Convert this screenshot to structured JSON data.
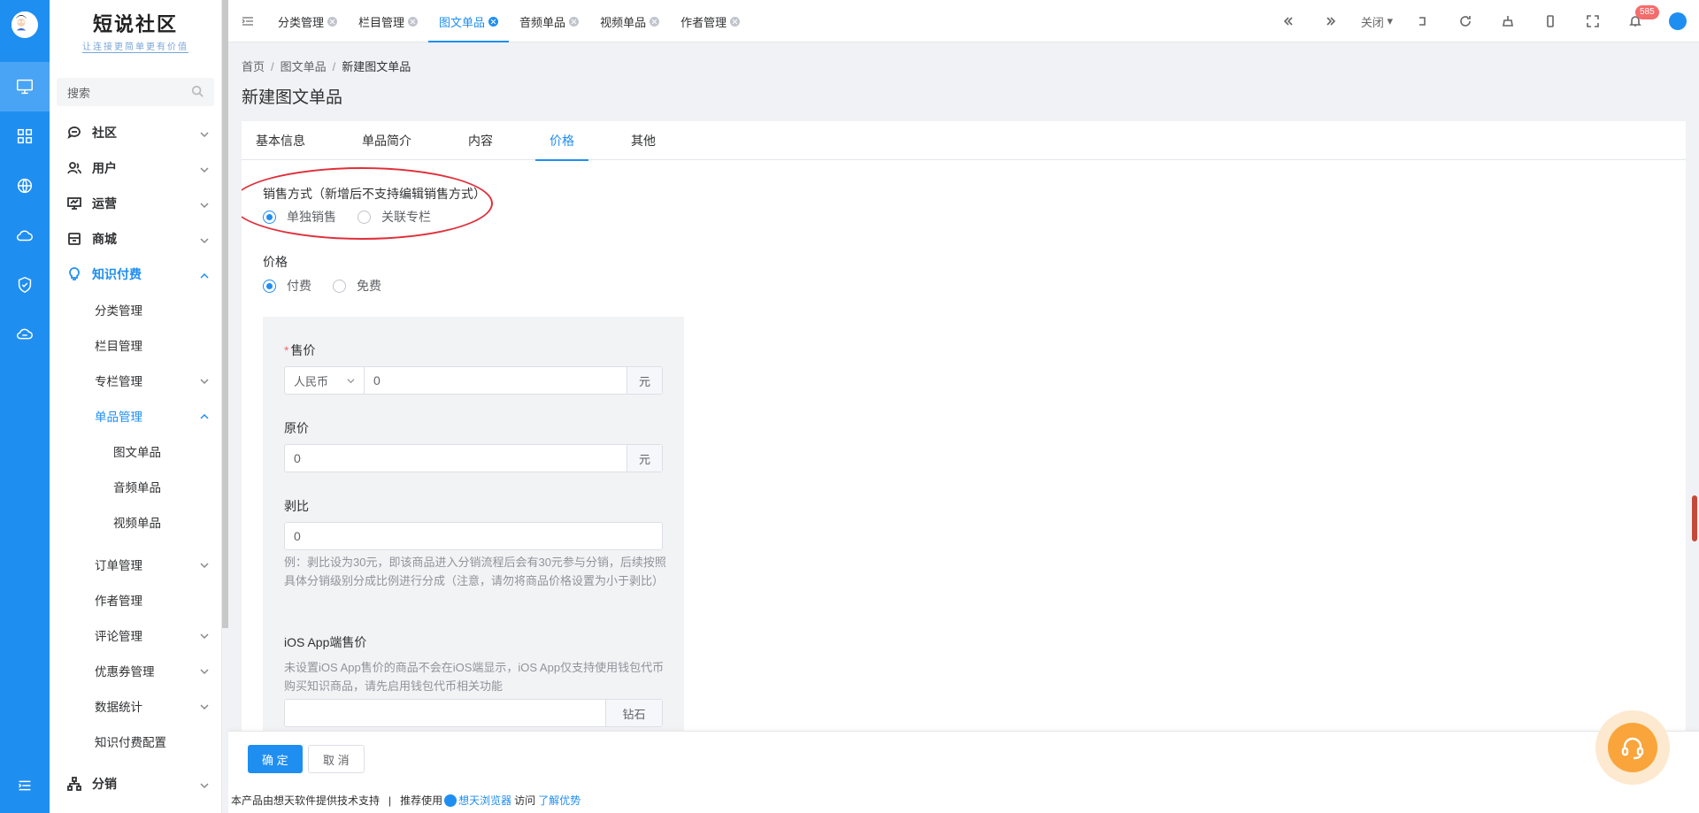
{
  "brand": {
    "title": "短说社区",
    "subtitle": "让连接更简单更有价值"
  },
  "search": {
    "placeholder": "搜索"
  },
  "sidebar": {
    "items": [
      {
        "label": "社区",
        "level": 0,
        "icon": "chat-icon",
        "expanded": false
      },
      {
        "label": "用户",
        "level": 0,
        "icon": "users-icon",
        "expanded": false
      },
      {
        "label": "运营",
        "level": 0,
        "icon": "monitor-chart-icon",
        "expanded": false
      },
      {
        "label": "商城",
        "level": 0,
        "icon": "shop-icon",
        "expanded": false
      },
      {
        "label": "知识付费",
        "level": 0,
        "icon": "bulb-icon",
        "expanded": true
      },
      {
        "label": "分类管理",
        "level": 1
      },
      {
        "label": "栏目管理",
        "level": 1
      },
      {
        "label": "专栏管理",
        "level": 1,
        "expanded": false
      },
      {
        "label": "单品管理",
        "level": 1,
        "expanded": true
      },
      {
        "label": "图文单品",
        "level": 2
      },
      {
        "label": "音频单品",
        "level": 2
      },
      {
        "label": "视频单品",
        "level": 2
      },
      {
        "label": "订单管理",
        "level": 1,
        "expanded": false
      },
      {
        "label": "作者管理",
        "level": 1
      },
      {
        "label": "评论管理",
        "level": 1,
        "expanded": false
      },
      {
        "label": "优惠券管理",
        "level": 1,
        "expanded": false
      },
      {
        "label": "数据统计",
        "level": 1,
        "expanded": false
      },
      {
        "label": "知识付费配置",
        "level": 1
      },
      {
        "label": "分销",
        "level": 0,
        "icon": "share-tree-icon",
        "expanded": false
      }
    ]
  },
  "tabs": [
    {
      "label": "分类管理"
    },
    {
      "label": "栏目管理"
    },
    {
      "label": "图文单品",
      "active": true
    },
    {
      "label": "音频单品"
    },
    {
      "label": "视频单品"
    },
    {
      "label": "作者管理"
    }
  ],
  "toolbar": {
    "close_label": "关闭",
    "notification_count": "585"
  },
  "breadcrumb": {
    "home": "首页",
    "parent": "图文单品",
    "current": "新建图文单品"
  },
  "page_title": "新建图文单品",
  "form_tabs": [
    {
      "label": "基本信息"
    },
    {
      "label": "单品简介"
    },
    {
      "label": "内容"
    },
    {
      "label": "价格",
      "active": true
    },
    {
      "label": "其他"
    }
  ],
  "sale_mode": {
    "label": "销售方式（新增后不支持编辑销售方式）",
    "options": [
      "单独销售",
      "关联专栏"
    ],
    "selected": "单独销售"
  },
  "price_type": {
    "label": "价格",
    "options": [
      "付费",
      "免费"
    ],
    "selected": "付费"
  },
  "sale_price": {
    "required_mark": "*",
    "label": "售价",
    "currency": "人民币",
    "value": "0",
    "unit": "元"
  },
  "original_price": {
    "label": "原价",
    "value": "0",
    "unit": "元"
  },
  "commission": {
    "label": "剥比",
    "value": "0",
    "hint": "例：剥比设为30元，即该商品进入分销流程后会有30元参与分销，后续按照具体分销级别分成比例进行分成（注意，请勿将商品价格设置为小于剥比）"
  },
  "ios_price": {
    "label": "iOS App端售价",
    "hint": "未设置iOS App售价的商品不会在iOS端显示，iOS App仅支持使用钱包代币购买知识商品，请先启用钱包代币相关功能",
    "value": "",
    "unit": "钻石"
  },
  "actions": {
    "confirm": "确 定",
    "cancel": "取 消"
  },
  "footer": {
    "support": "本产品由想天软件提供技术支持",
    "sep": "|",
    "recommend": "推荐使用",
    "browser": "想天浏览器",
    "visit": "访问",
    "link": "了解优势"
  },
  "colors": {
    "primary": "#1f8ef1",
    "highlight_ellipse": "#e02f3a",
    "badge": "#f56c6c",
    "help_button": "#f9a53c"
  }
}
